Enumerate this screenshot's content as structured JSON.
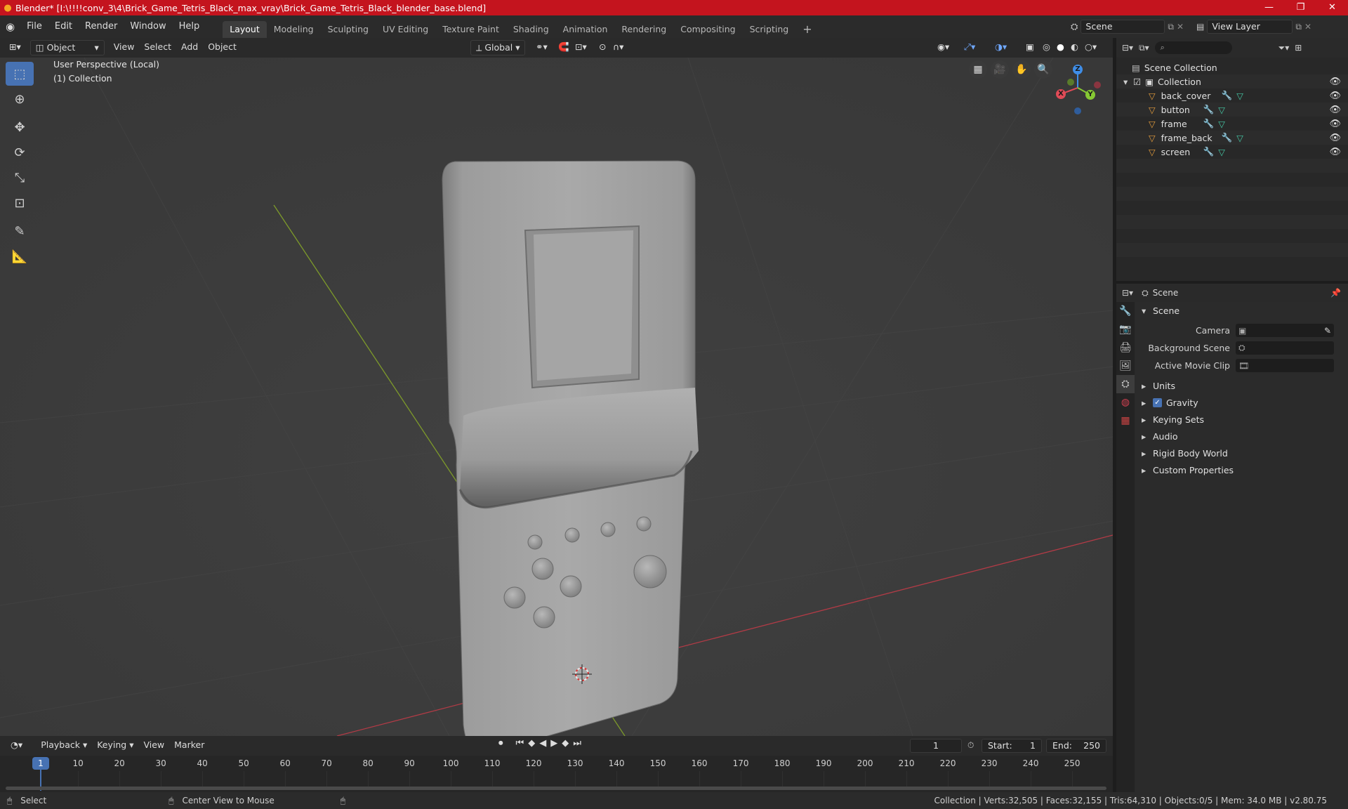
{
  "window": {
    "title": "Blender* [I:\\!!!!conv_3\\4\\Brick_Game_Tetris_Black_max_vray\\Brick_Game_Tetris_Black_blender_base.blend]",
    "minimize": "—",
    "maximize": "❐",
    "close": "✕"
  },
  "menu": {
    "items": [
      "File",
      "Edit",
      "Render",
      "Window",
      "Help"
    ],
    "workspaces": [
      "Layout",
      "Modeling",
      "Sculpting",
      "UV Editing",
      "Texture Paint",
      "Shading",
      "Animation",
      "Rendering",
      "Compositing",
      "Scripting"
    ],
    "add_workspace": "+",
    "scene_name": "Scene",
    "view_layer": "View Layer"
  },
  "viewport_header": {
    "mode": "Object Mode",
    "menus": [
      "View",
      "Select",
      "Add",
      "Object"
    ],
    "transform_orientation": "Global"
  },
  "viewport": {
    "perspective_label": "User Perspective (Local)",
    "collection_label": "(1) Collection",
    "gizmo": {
      "x": "X",
      "y": "Y",
      "z": "Z"
    }
  },
  "outliner": {
    "search_placeholder": "",
    "root": "Scene Collection",
    "collection": "Collection",
    "objects": [
      "back_cover",
      "button",
      "frame",
      "frame_back",
      "screen"
    ]
  },
  "properties": {
    "context": "Scene",
    "section": "Scene",
    "fields": [
      {
        "label": "Camera",
        "value": ""
      },
      {
        "label": "Background Scene",
        "value": ""
      },
      {
        "label": "Active Movie Clip",
        "value": ""
      }
    ],
    "subsections": [
      "Units",
      "Gravity",
      "Keying Sets",
      "Audio",
      "Rigid Body World",
      "Custom Properties"
    ],
    "gravity_checked": true
  },
  "timeline": {
    "menus": [
      "Playback",
      "Keying",
      "View",
      "Marker"
    ],
    "current_frame": "1",
    "start_label": "Start:",
    "start": "1",
    "end_label": "End:",
    "end": "250",
    "ticks": [
      "1",
      "10",
      "20",
      "30",
      "40",
      "50",
      "60",
      "70",
      "80",
      "90",
      "100",
      "110",
      "120",
      "130",
      "140",
      "150",
      "160",
      "170",
      "180",
      "190",
      "200",
      "210",
      "220",
      "230",
      "240",
      "250"
    ]
  },
  "statusbar": {
    "left_hint": "Select",
    "middle_hint": "Center View to Mouse",
    "stats": "Collection | Verts:32,505 | Faces:32,155 | Tris:64,310 | Objects:0/5 | Mem: 34.0 MB | v2.80.75"
  },
  "colors": {
    "titlebar": "#c4141e",
    "accent": "#4772b3",
    "axis_x": "#e14b57",
    "axis_y": "#86c933",
    "axis_z": "#3f8ee8",
    "object_icon": "#e39b3c",
    "mesh_icon": "#45c8a5"
  }
}
